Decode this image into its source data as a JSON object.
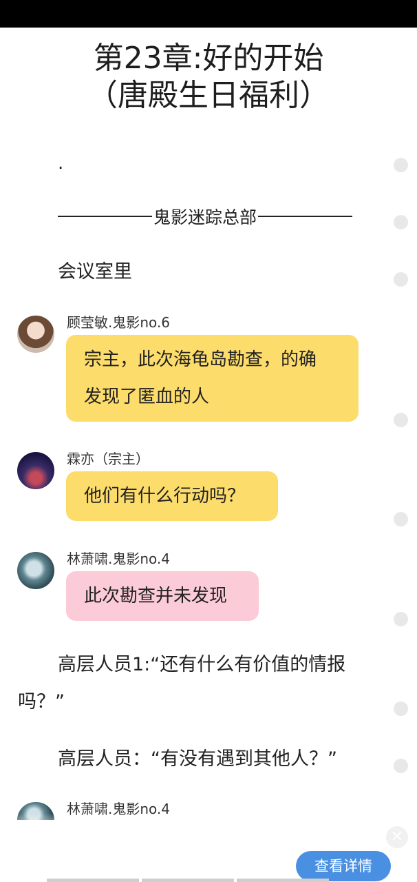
{
  "chapter": {
    "title_line1": "第23章:好的开始",
    "title_line2": "（唐殿生日福利）"
  },
  "content": {
    "dot": ".",
    "divider_label": "鬼影迷踪总部",
    "scene": "会议室里",
    "messages": [
      {
        "speaker": "顾莹敏.鬼影no.6",
        "line1": "宗主，此次海龟岛勘查，的确",
        "line2": "发现了匿血的人",
        "color": "yellow"
      },
      {
        "speaker": "霖亦（宗主）",
        "text": "他们有什么行动吗？",
        "color": "yellow"
      },
      {
        "speaker": "林萧啸.鬼影no.4",
        "text": "此次勘查并未发现",
        "color": "pink"
      }
    ],
    "para1_line1": "高层人员1:“还有什么有价值的情报",
    "para1_line2": "吗？”",
    "para2": "高层人员：“有没有遇到其他人？”",
    "last_speaker": "林萧啸.鬼影no.4"
  },
  "controls": {
    "close_icon": "close-icon",
    "close_glyph": "✕",
    "detail_button": "查看详情"
  },
  "colors": {
    "bubble_yellow": "#fcdc6b",
    "bubble_pink": "#fbcbd7",
    "button_blue": "#4a90e2"
  }
}
